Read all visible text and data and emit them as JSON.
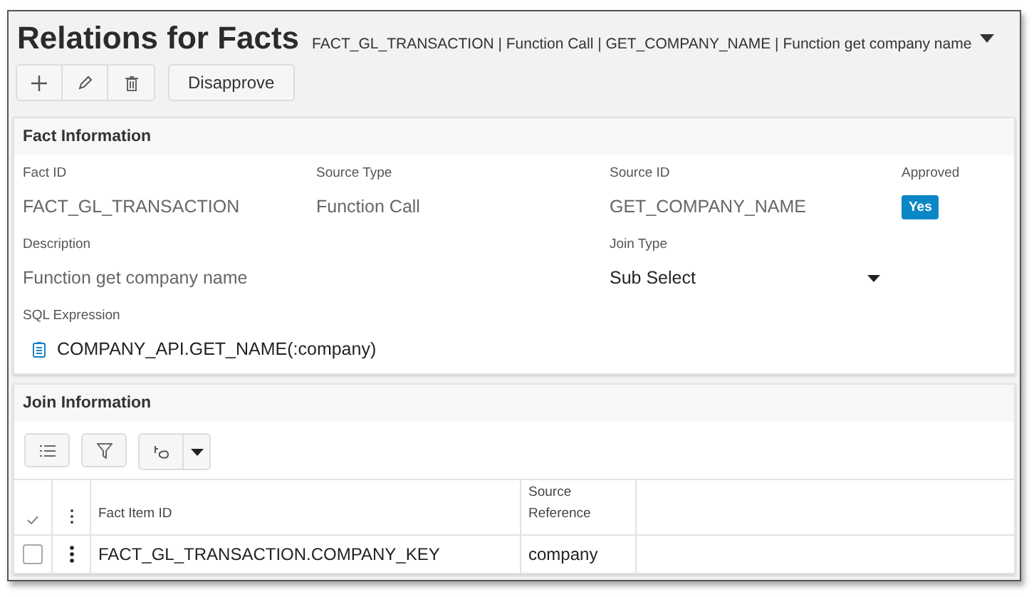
{
  "page": {
    "title": "Relations for Facts",
    "breadcrumb": "FACT_GL_TRANSACTION | Function Call | GET_COMPANY_NAME | Function get company name"
  },
  "toolbar": {
    "action_button": "Disapprove"
  },
  "fact_information": {
    "title": "Fact Information",
    "rows": [
      [
        {
          "label": "Fact ID",
          "value": "FACT_GL_TRANSACTION",
          "kind": "text"
        },
        {
          "label": "Source Type",
          "value": "Function Call",
          "kind": "text"
        },
        {
          "label": "Source ID",
          "value": "GET_COMPANY_NAME",
          "kind": "text"
        },
        {
          "label": "Approved",
          "value": "Yes",
          "kind": "badge"
        }
      ],
      [
        {
          "label": "Description",
          "value": "Function get company name",
          "kind": "text"
        },
        {
          "kind": "empty"
        },
        {
          "label": "Join Type",
          "value": "Sub Select",
          "kind": "select"
        }
      ],
      [
        {
          "label": "SQL Expression",
          "value": "COMPANY_API.GET_NAME(:company)",
          "kind": "expression"
        }
      ]
    ]
  },
  "join_information": {
    "title": "Join Information",
    "table": {
      "columns": [
        "Fact Item ID",
        "Source Reference"
      ],
      "rows": [
        {
          "checked": false,
          "cells": [
            "FACT_GL_TRANSACTION.COMPANY_KEY",
            "company"
          ]
        }
      ]
    }
  }
}
